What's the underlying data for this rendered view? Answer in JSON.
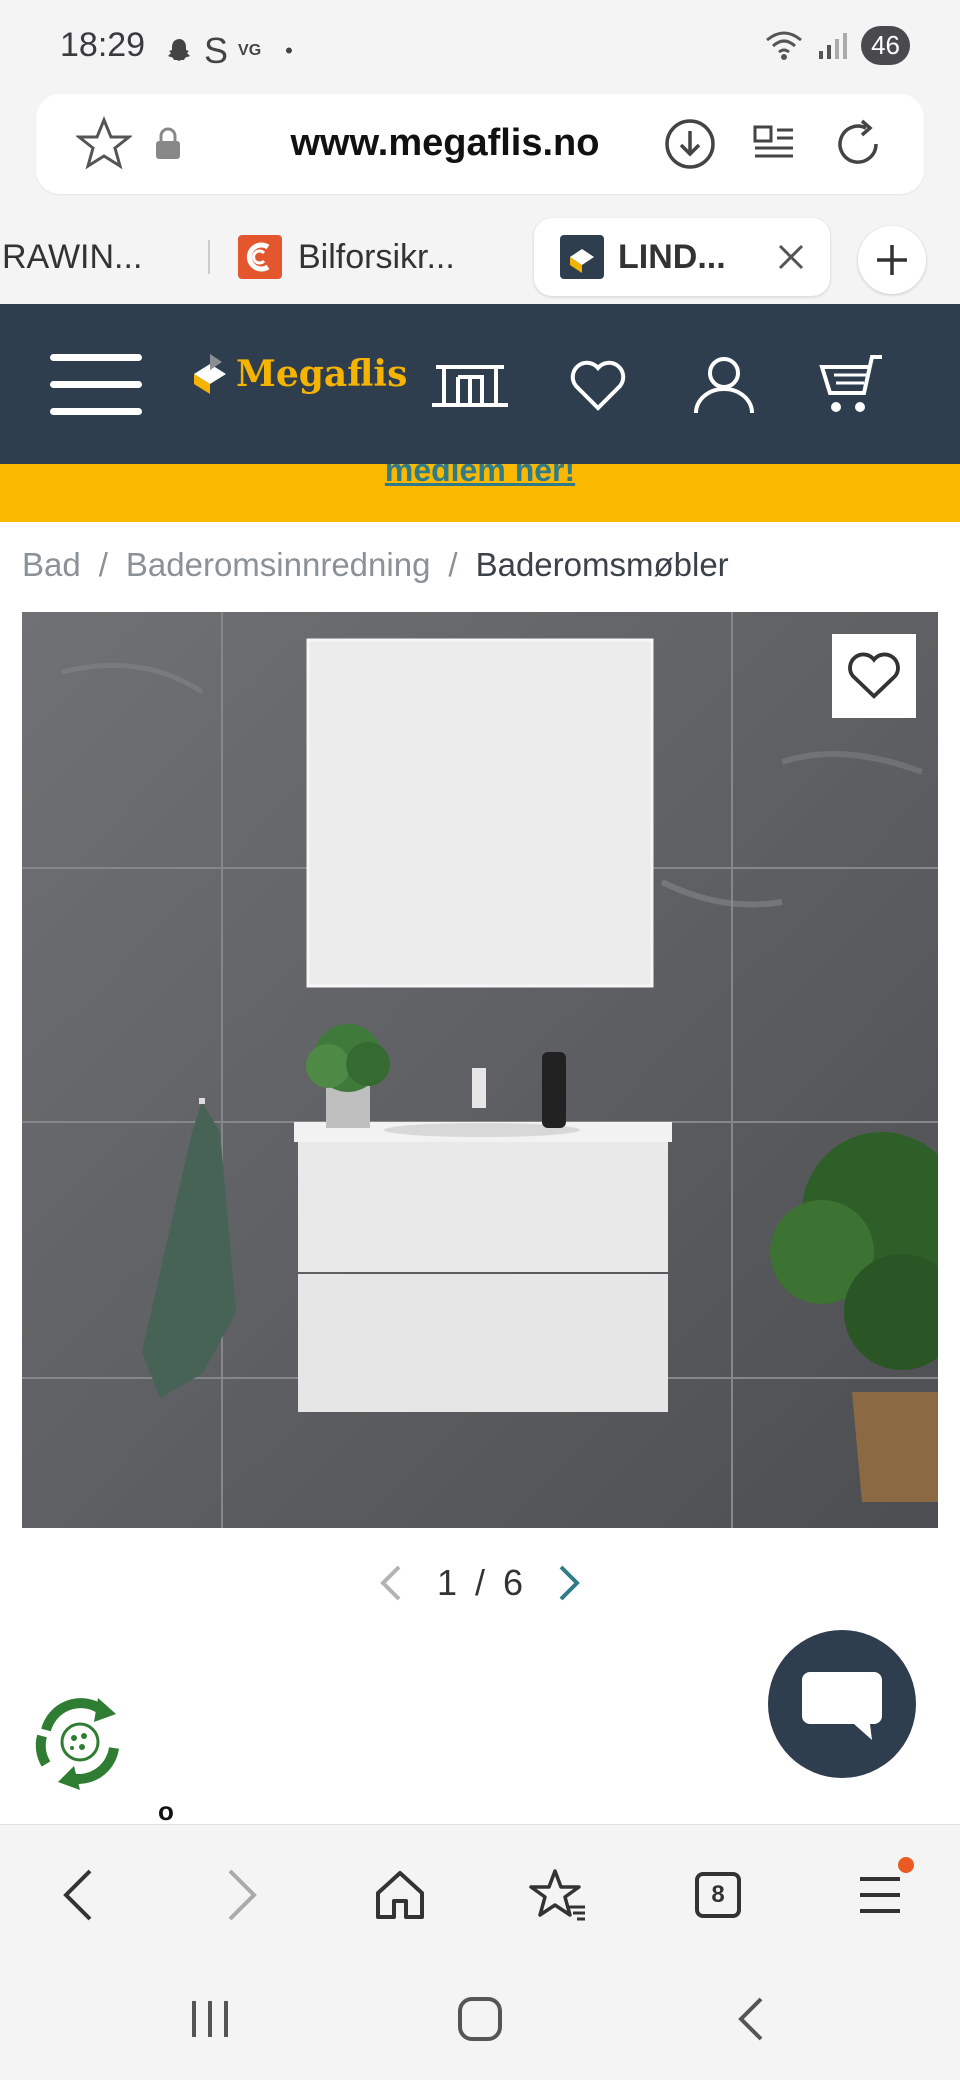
{
  "status_bar": {
    "time": "18:29",
    "left_glyphs": [
      "S",
      "VG",
      "•"
    ],
    "battery": "46"
  },
  "url_bar": {
    "url": "www.megaflis.no"
  },
  "tabs": [
    {
      "label": "RAWIN...",
      "active": false
    },
    {
      "label": "Bilforsikr...",
      "active": false
    },
    {
      "label": "LIND...",
      "active": true
    }
  ],
  "site": {
    "logo": "Megaflis",
    "promo_link": "medlem her!",
    "accent": "#fbb800",
    "header_color": "#2e3e4e"
  },
  "breadcrumb": {
    "items": [
      "Bad",
      "Baderomsinnredning",
      "Baderomsmøbler"
    ],
    "separator": "/"
  },
  "gallery": {
    "current": "1",
    "separator": "/",
    "total": "6"
  },
  "badge": "o",
  "toolbar": {
    "tab_count": "8"
  },
  "icons": {
    "url_bar": [
      "star-icon",
      "lock-icon",
      "download-icon",
      "reader-icon",
      "reload-icon"
    ],
    "header": [
      "menu-icon",
      "showroom-icon",
      "heart-icon",
      "user-icon",
      "cart-icon"
    ],
    "toolbar": [
      "back-icon",
      "forward-icon",
      "home-icon",
      "bookmarks-icon",
      "tabs-icon",
      "menu-icon"
    ],
    "navbar": [
      "recents-icon",
      "home-icon",
      "back-icon"
    ]
  }
}
